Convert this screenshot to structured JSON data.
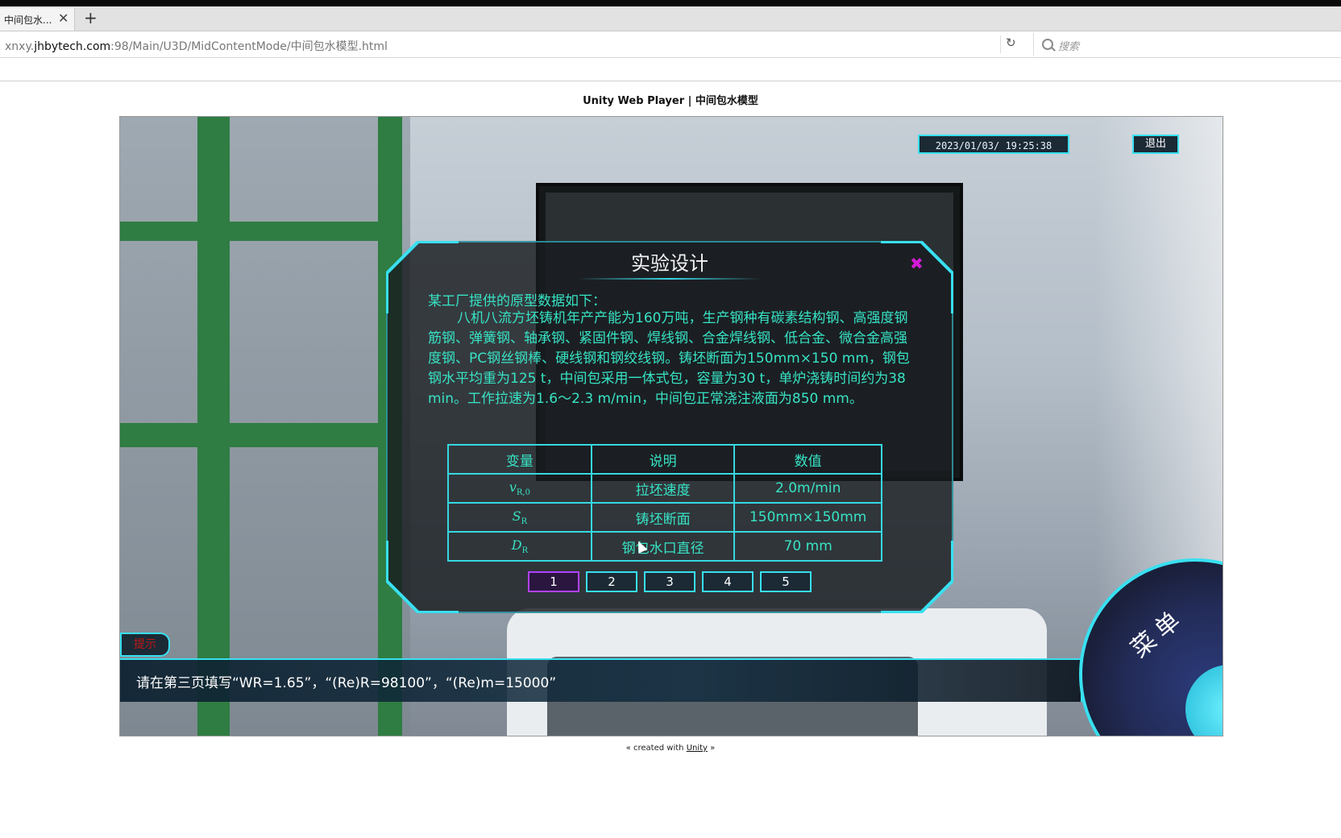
{
  "browser": {
    "tab_title": "中间包水...",
    "tab_close": "✕",
    "new_tab": "+",
    "url_prefix": "xnxy.",
    "url_host": "jhbytech.com",
    "url_path": ":98/Main/U3D/MidContentMode/中间包水模型.html",
    "reload_glyph": "↻",
    "search_placeholder": "搜索"
  },
  "page": {
    "heading": "Unity Web Player | 中间包水模型",
    "footer_prefix": "« created with ",
    "footer_link": "Unity",
    "footer_suffix": " »"
  },
  "hud": {
    "datetime": "2023/01/03/ 19:25:38",
    "exit_label": "退出",
    "hint_tab_label": "提示",
    "hint_text": "请在第三页填写“WR=1.65”，“(Re)R=98100”，“(Re)m=15000”",
    "menu_label": "菜单"
  },
  "dialog": {
    "title": "实验设计",
    "close_glyph": "✖",
    "intro_heading": "某工厂提供的原型数据如下：",
    "intro_body": "八机八流方坯铸机年产产能为160万吨，生产钢种有碳素结构钢、高强度钢筋钢、弹簧钢、轴承钢、紧固件钢、焊线钢、合金焊线钢、低合金、微合金高强度钢、PC钢丝钢棒、硬线钢和钢绞线钢。铸坯断面为150mm×150 mm，钢包钢水平均重为125 t，中间包采用一体式包，容量为30 t，单炉浇铸时间约为38 min。工作拉速为1.6～2.3 m/min，中间包正常浇注液面为850 mm。",
    "table": {
      "headers": [
        "变量",
        "说明",
        "数值"
      ],
      "rows": [
        {
          "symbol": "v",
          "sub": "R,0",
          "desc": "拉坯速度",
          "value": "2.0m/min"
        },
        {
          "symbol": "S",
          "sub": "R",
          "desc": "铸坯断面",
          "value": "150mm×150mm"
        },
        {
          "symbol": "D",
          "sub": "R",
          "desc": "钢包水口直径",
          "value": "70 mm"
        }
      ]
    },
    "pages": [
      "1",
      "2",
      "3",
      "4",
      "5"
    ],
    "active_page": "1"
  },
  "colors": {
    "accent_cyan": "#38e0f0",
    "text_teal": "#37e3c4",
    "active_page_border": "#b042ff",
    "close_magenta": "#d21ad6",
    "hint_red": "#c01818"
  },
  "icons": {
    "search": "search-icon",
    "reload": "reload-icon",
    "close": "close-icon"
  }
}
